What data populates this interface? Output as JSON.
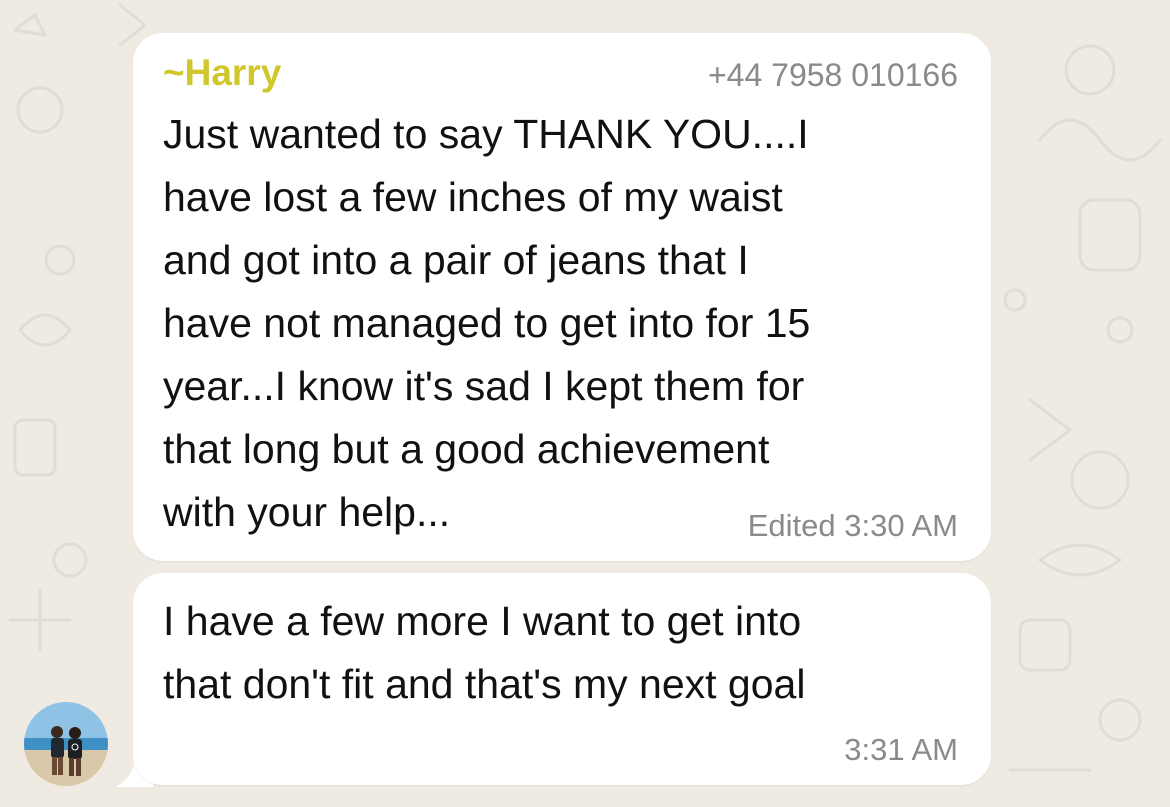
{
  "chat": {
    "messages": [
      {
        "sender_prefix": "~",
        "sender_name": "Harry",
        "sender_phone": "+44 7958 010166",
        "text": "Just wanted to say THANK YOU....I\nhave lost a few inches of my waist\nand got into a pair of jeans that I\nhave not managed to get into for 15\nyear...I know it's sad I kept them for\nthat long but a good achievement\nwith your help...",
        "meta": "Edited 3:30 AM"
      },
      {
        "text": "I have a few more I want to get into\nthat don't fit and that's my next goal",
        "meta": "3:31 AM"
      }
    ]
  },
  "colors": {
    "background": "#efeae2",
    "bubble": "#ffffff",
    "sender_name": "#d0c72c",
    "meta_text": "#8a8a8a",
    "message_text": "#111111"
  },
  "icons": {
    "avatar": "contact-avatar-photo"
  }
}
